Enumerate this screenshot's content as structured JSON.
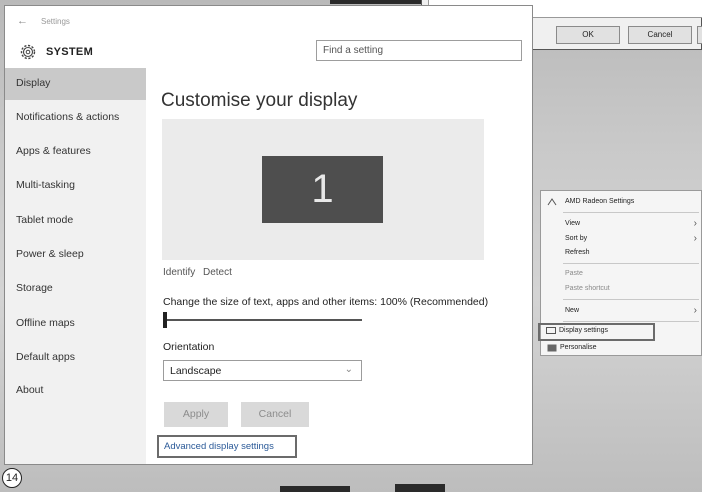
{
  "window": {
    "title": "Settings"
  },
  "header": {
    "section": "SYSTEM",
    "search_placeholder": "Find a setting"
  },
  "sidebar": {
    "items": [
      {
        "label": "Display",
        "active": true
      },
      {
        "label": "Notifications & actions"
      },
      {
        "label": "Apps & features"
      },
      {
        "label": "Multi-tasking"
      },
      {
        "label": "Tablet mode"
      },
      {
        "label": "Power & sleep"
      },
      {
        "label": "Storage"
      },
      {
        "label": "Offline maps"
      },
      {
        "label": "Default apps"
      },
      {
        "label": "About"
      }
    ]
  },
  "main": {
    "title": "Customise your display",
    "monitor_number": "1",
    "identify_label": "Identify",
    "detect_label": "Detect",
    "scale_label": "Change the size of text, apps and other items: 100% (Recommended)",
    "scale_slider_value": 0,
    "orientation_label": "Orientation",
    "orientation_value": "Landscape",
    "apply_label": "Apply",
    "cancel_label": "Cancel",
    "advanced_link": "Advanced display settings"
  },
  "dialog": {
    "ok_label": "OK",
    "cancel_label": "Cancel"
  },
  "context_menu": {
    "items": [
      {
        "label": "AMD Radeon Settings",
        "icon": "amd-icon"
      },
      {
        "label": "View",
        "submenu": true
      },
      {
        "label": "Sort by",
        "submenu": true
      },
      {
        "label": "Refresh"
      },
      {
        "label": "Paste",
        "disabled": true
      },
      {
        "label": "Paste shortcut",
        "disabled": true
      },
      {
        "label": "New",
        "submenu": true
      },
      {
        "label": "Display settings",
        "icon": "display-icon",
        "highlighted": true
      },
      {
        "label": "Personalise",
        "icon": "personalise-icon"
      }
    ]
  },
  "step_number": "14",
  "colors": {
    "active_nav": "#c9c9c9",
    "link": "#2b5a98",
    "monitor": "#4e4e4e"
  }
}
